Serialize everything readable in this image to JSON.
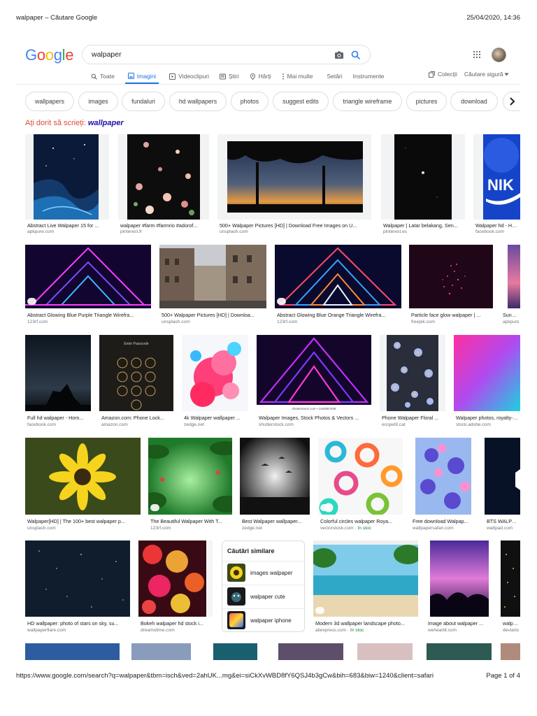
{
  "print_header": {
    "title": "walpaper – Căutare Google",
    "datetime": "25/04/2020, 14:36"
  },
  "print_footer": {
    "url": "https://www.google.com/search?q=walpaper&tbm=isch&ved=2ahUK...mg&ei=siCkXvWBD8fY6QSJ4b3gCw&bih=683&biw=1240&client=safari",
    "page": "Page 1 of 4"
  },
  "search": {
    "query": "walpaper"
  },
  "tabs": [
    {
      "label": "Toate"
    },
    {
      "label": "Imagini"
    },
    {
      "label": "Videoclipuri"
    },
    {
      "label": "Știri"
    },
    {
      "label": "Hărți"
    },
    {
      "label": "Mai multe"
    },
    {
      "label": "Setări"
    },
    {
      "label": "Instrumente"
    }
  ],
  "right_tabs": {
    "collections": "Colecții",
    "safe_search": "Căutare sigură"
  },
  "chips": [
    "wallpapers",
    "images",
    "fundaluri",
    "hd wallpapers",
    "photos",
    "suggest edits",
    "triangle wireframe",
    "pictures",
    "download"
  ],
  "did_you_mean": {
    "prefix": "Ați dorit să scrieți:",
    "suggestion": "wallpaper"
  },
  "results": [
    {
      "title": "Abstract Live Walpaper 15 for ...",
      "source": "apkpure.com"
    },
    {
      "title": "walpaper #farm #farmrio #adorof...",
      "source": "pinterest.fr"
    },
    {
      "title": "500+ Walpaper Pictures [HD] | Download Free Images on U...",
      "source": "unsplash.com"
    },
    {
      "title": "Walpaper | Latar belakang, Sen...",
      "source": "pinterest.es"
    },
    {
      "title": "Walpaper hd - Home",
      "source": "facebook.com"
    },
    {
      "title": "Abstract Glowing Blue Purple Triangle Wirefra...",
      "source": "123rf.com"
    },
    {
      "title": "500+ Walpaper Pictures [HD] | Downloa...",
      "source": "unsplash.com"
    },
    {
      "title": "Abstract Glowing Blue Orange Triangle Wirefra...",
      "source": "123rf.com"
    },
    {
      "title": "Particle face glow walpaper | ...",
      "source": "freepik.com"
    },
    {
      "title": "Sunset walpaper",
      "source": "apkpure.com"
    },
    {
      "title": "Full hd walpaper - Hom...",
      "source": "facebook.com"
    },
    {
      "title": "Amazon.com: Phone Lock...",
      "source": "amazon.com"
    },
    {
      "title": "4k Walpaper wallpaper ...",
      "source": "zedge.net"
    },
    {
      "title": "Walpaper Images, Stock Photos & Vectors ...",
      "source": "shutterstock.com"
    },
    {
      "title": "Phone Walpaper Floral ...",
      "source": "ecopetit.cat"
    },
    {
      "title": "Walpaper photos, royalty-free",
      "source": "stock.adobe.com"
    },
    {
      "title": "Walpaper[HD] | The 100+ best walpaper p...",
      "source": "unsplash.com"
    },
    {
      "title": "The Beautiful Walpaper With T...",
      "source": "123rf.com"
    },
    {
      "title": "Best Walpaper wallpaper...",
      "source": "zedge.net"
    },
    {
      "title": "Colorful circles walpaper Roya...",
      "source": "vectorstock.com",
      "stock": "În stoc"
    },
    {
      "title": "Free download Walpap...",
      "source": "wallpapersafari.com"
    },
    {
      "title": "BTS WALPAPER",
      "source": "wattpad.com"
    },
    {
      "title": "HD wallpaper: photo of stars on sky, su...",
      "source": "wallpaperflare.com"
    },
    {
      "title": "Bokeh walpaper hd stock i...",
      "source": "dreamstime.com"
    },
    {
      "title": "Modern 3d wallpaper landscape photo...",
      "source": "aliexpress.com",
      "stock": "În stoc"
    },
    {
      "title": "Image about walpaper ...",
      "source": "weheartit.com"
    },
    {
      "title": "walpaper",
      "source": "deviantart.com"
    }
  ],
  "related": {
    "title": "Căutări similare",
    "items": [
      "images walpaper",
      "walpaper cute",
      "walpaper iphone"
    ]
  },
  "colors": {
    "accent": "#1a73e8",
    "did_you_mean": "#dd4b39",
    "link": "#1a0dab"
  }
}
